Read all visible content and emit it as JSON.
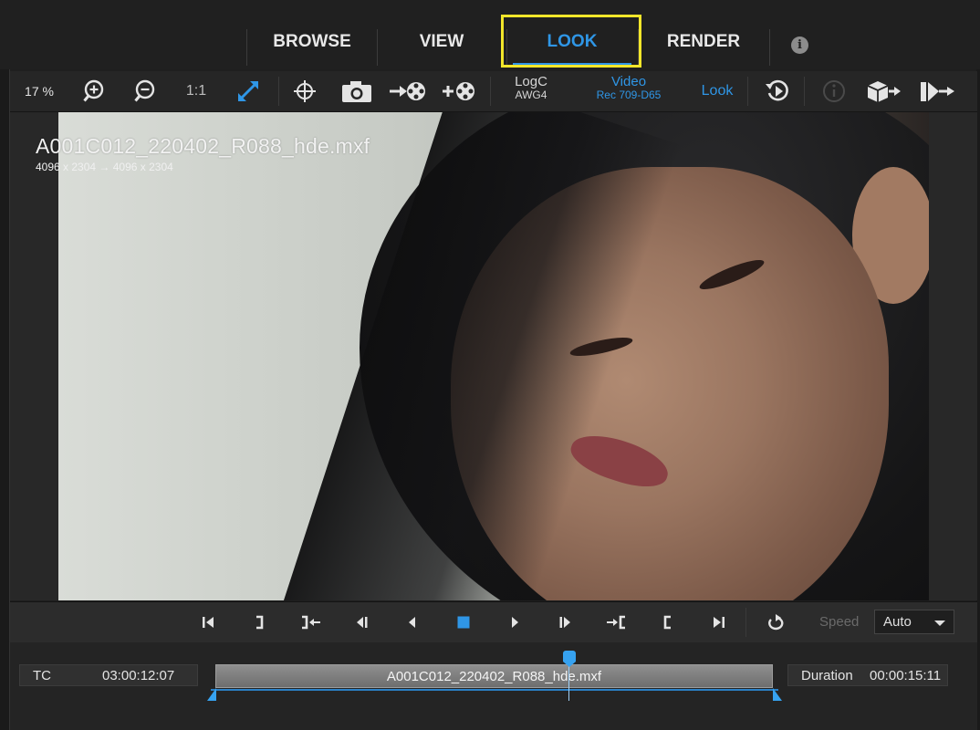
{
  "tabs": {
    "browse": "BROWSE",
    "view": "VIEW",
    "look": "LOOK",
    "render": "RENDER",
    "active": "LOOK",
    "info_glyph": "i"
  },
  "toolbar": {
    "zoom_percent": "17 %",
    "one_to_one": "1:1",
    "input_cs_main": "LogC",
    "input_cs_sub": "AWG4",
    "output_cs_main": "Video",
    "output_cs_sub": "Rec 709-D65",
    "look_label": "Look",
    "icons": [
      "zoom-in-icon",
      "zoom-out-icon",
      "fit-icon",
      "crosshair-icon",
      "camera-icon",
      "export-frame-icon",
      "add-frame-icon",
      "history-icon",
      "info-icon",
      "export-cube-icon",
      "render-icon"
    ]
  },
  "viewer": {
    "clip_name": "A001C012_220402_R088_hde.mxf",
    "resolution": "4096 x 2304  → 4096 x 2304"
  },
  "transport": {
    "speed_label": "Speed",
    "speed_value": "Auto"
  },
  "timeline": {
    "tc_label": "TC",
    "tc_value": "03:00:12:07",
    "clip_name": "A001C012_220402_R088_hde.mxf",
    "duration_label": "Duration",
    "duration_value": "00:00:15:11"
  },
  "colors": {
    "accent": "#2f96e6",
    "highlight": "#f2e62a",
    "background": "#1f1f1f"
  }
}
